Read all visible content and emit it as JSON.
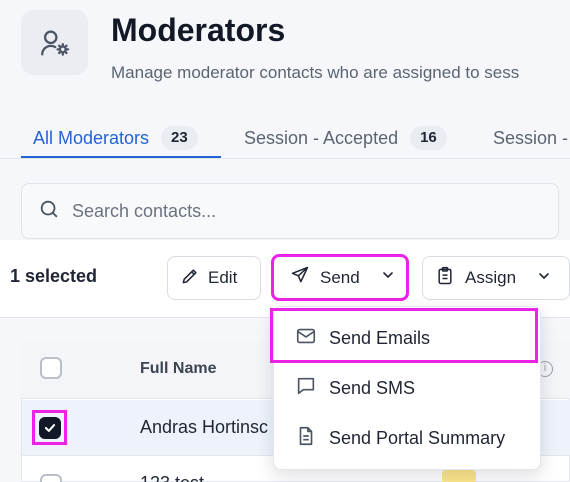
{
  "header": {
    "title": "Moderators",
    "subtitle": "Manage moderator contacts who are assigned to sess"
  },
  "tabs": [
    {
      "label": "All Moderators",
      "count": "23",
      "active": true
    },
    {
      "label": "Session - Accepted",
      "count": "16",
      "active": false
    },
    {
      "label": "Session -",
      "count": "",
      "active": false
    }
  ],
  "search": {
    "placeholder": "Search contacts..."
  },
  "toolbar": {
    "selected_count": "1 selected",
    "edit_label": "Edit",
    "send_label": "Send",
    "assign_label": "Assign"
  },
  "send_menu": {
    "items": [
      {
        "label": "Send Emails",
        "icon": "mail-icon"
      },
      {
        "label": "Send SMS",
        "icon": "chat-icon"
      },
      {
        "label": "Send Portal Summary",
        "icon": "document-icon"
      }
    ]
  },
  "table": {
    "columns": [
      "Full Name"
    ],
    "rows": [
      {
        "name": "Andras Hortinsc",
        "selected": true
      },
      {
        "name": "123 test",
        "selected": false
      }
    ]
  },
  "colors": {
    "accent": "#2463d6",
    "highlight": "#ec22e6",
    "row_selected": "#eef3fb"
  }
}
